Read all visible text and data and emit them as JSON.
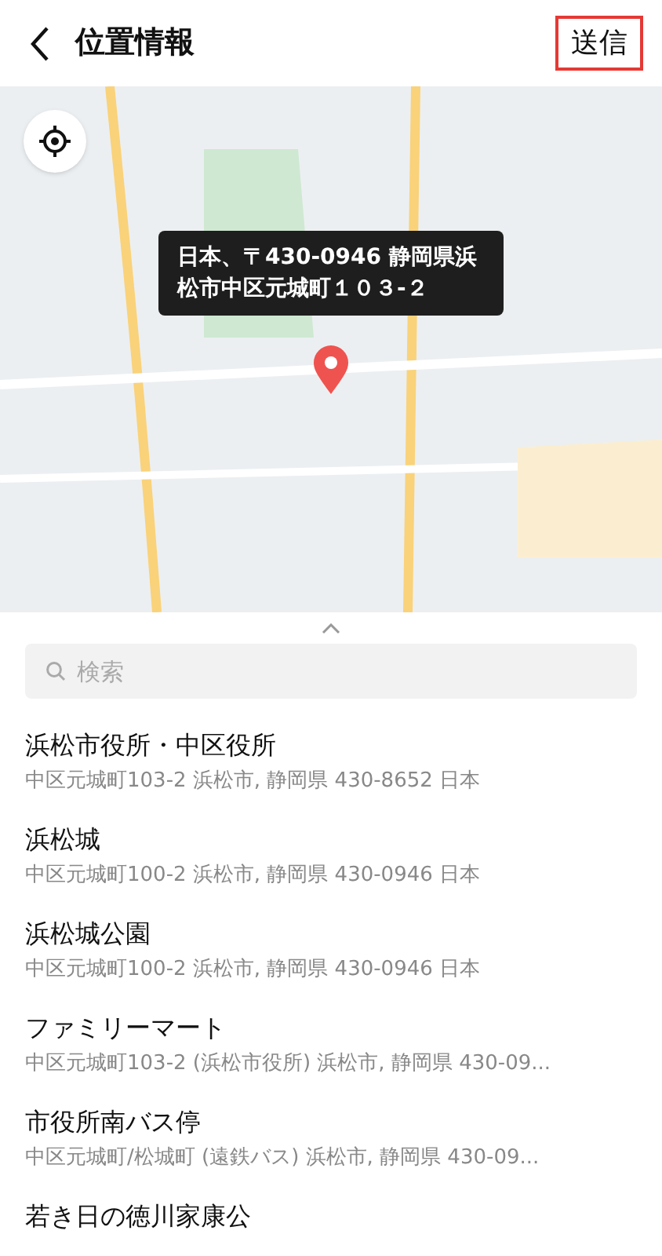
{
  "header": {
    "title": "位置情報",
    "send_button": "送信"
  },
  "map": {
    "tooltip": "日本、〒430-0946 静岡県浜松市中区元城町１０３-２"
  },
  "search": {
    "placeholder": "検索"
  },
  "places": [
    {
      "name": "浜松市役所・中区役所",
      "address": "中区元城町103-2 浜松市, 静岡県 430-8652 日本"
    },
    {
      "name": "浜松城",
      "address": "中区元城町100-2 浜松市, 静岡県 430-0946 日本"
    },
    {
      "name": "浜松城公園",
      "address": "中区元城町100-2 浜松市, 静岡県 430-0946 日本"
    },
    {
      "name": "ファミリーマート",
      "address": "中区元城町103-2 (浜松市役所) 浜松市, 静岡県 430-09..."
    },
    {
      "name": "市役所南バス停",
      "address": "中区元城町/松城町 (遠鉄バス) 浜松市, 静岡県 430-09..."
    },
    {
      "name": "若き日の徳川家康公"
    }
  ]
}
